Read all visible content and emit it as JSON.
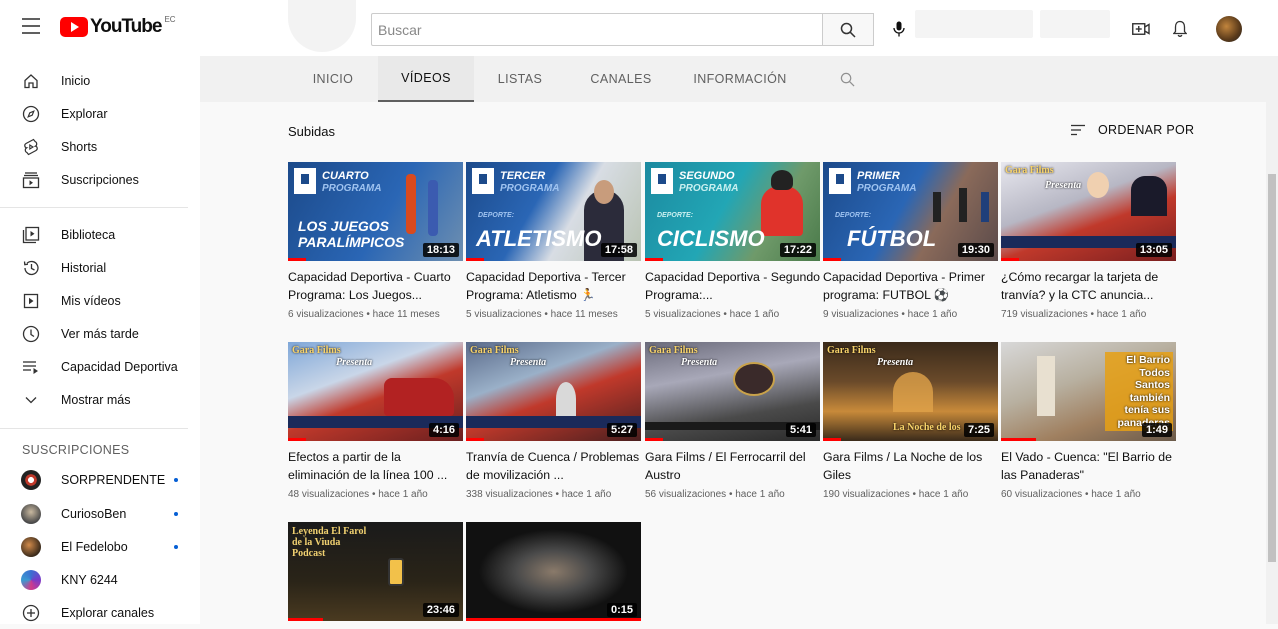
{
  "header": {
    "logo_text": "YouTube",
    "country_code": "EC",
    "search_placeholder": "Buscar"
  },
  "sidebar": {
    "main": [
      {
        "label": "Inicio",
        "icon": "home-icon"
      },
      {
        "label": "Explorar",
        "icon": "compass-icon"
      },
      {
        "label": "Shorts",
        "icon": "shorts-icon"
      },
      {
        "label": "Suscripciones",
        "icon": "subscriptions-icon"
      }
    ],
    "library": [
      {
        "label": "Biblioteca",
        "icon": "library-icon"
      },
      {
        "label": "Historial",
        "icon": "history-icon"
      },
      {
        "label": "Mis vídeos",
        "icon": "my-videos-icon"
      },
      {
        "label": "Ver más tarde",
        "icon": "clock-icon"
      },
      {
        "label": "Capacidad Deportiva",
        "icon": "playlist-icon"
      },
      {
        "label": "Mostrar más",
        "icon": "chevron-down-icon"
      }
    ],
    "subscriptions_heading": "SUSCRIPCIONES",
    "subscriptions": [
      {
        "label": "SORPRENDENTE",
        "new": true
      },
      {
        "label": "CuriosoBen",
        "new": true
      },
      {
        "label": "El Fedelobo",
        "new": true
      },
      {
        "label": "KNY 6244",
        "new": false
      }
    ],
    "explore_channels": "Explorar canales"
  },
  "tabs": [
    {
      "label": "INICIO",
      "active": false
    },
    {
      "label": "VÍDEOS",
      "active": true
    },
    {
      "label": "LISTAS",
      "active": false
    },
    {
      "label": "CANALES",
      "active": false
    },
    {
      "label": "INFORMACIÓN",
      "active": false
    }
  ],
  "section": {
    "title": "Subidas",
    "sort_label": "ORDENAR POR"
  },
  "videos": [
    {
      "title": "Capacidad Deportiva - Cuarto Programa: Los Juegos...",
      "views": "6 visualizaciones",
      "age": "hace 11 meses",
      "duration": "18:13",
      "thumb_line1": "CUARTO",
      "thumb_line2": "PROGRAMA",
      "thumb_main": "LOS JUEGOS PARALÍMPICOS",
      "progress": 0.1
    },
    {
      "title": "Capacidad Deportiva - Tercer Programa: Atletismo 🏃",
      "views": "5 visualizaciones",
      "age": "hace 11 meses",
      "duration": "17:58",
      "thumb_line1": "TERCER",
      "thumb_line2": "PROGRAMA",
      "thumb_sub": "DEPORTE:",
      "thumb_main": "ATLETISMO",
      "progress": 0.1
    },
    {
      "title": "Capacidad Deportiva - Segundo Programa:...",
      "views": "5 visualizaciones",
      "age": "hace 1 año",
      "duration": "17:22",
      "thumb_line1": "SEGUNDO",
      "thumb_line2": "PROGRAMA",
      "thumb_sub": "DEPORTE:",
      "thumb_main": "CICLISMO",
      "progress": 0.1
    },
    {
      "title": "Capacidad Deportiva - Primer programa: FUTBOL ⚽",
      "views": "9 visualizaciones",
      "age": "hace 1 año",
      "duration": "19:30",
      "thumb_line1": "PRIMER",
      "thumb_line2": "PROGRAMA",
      "thumb_sub": "DEPORTE:",
      "thumb_main": "FÚTBOL",
      "progress": 0.1
    },
    {
      "title": "¿Cómo recargar la tarjeta de tranvía? y la CTC anuncia...",
      "views": "719 visualizaciones",
      "age": "hace 1 año",
      "duration": "13:05",
      "thumb_brand": "Gara Films",
      "thumb_sub": "Presenta",
      "progress": 0.1
    },
    {
      "title": "Efectos a partir de la eliminación de la línea 100 ...",
      "views": "48 visualizaciones",
      "age": "hace 1 año",
      "duration": "4:16",
      "thumb_brand": "Gara Films",
      "thumb_sub": "Presenta",
      "progress": 0.1
    },
    {
      "title": "Tranvía de Cuenca / Problemas de movilización ...",
      "views": "338 visualizaciones",
      "age": "hace 1 año",
      "duration": "5:27",
      "thumb_brand": "Gara Films",
      "thumb_sub": "Presenta",
      "progress": 0.1
    },
    {
      "title": "Gara Films / El Ferrocarril del Austro",
      "views": "56 visualizaciones",
      "age": "hace 1 año",
      "duration": "5:41",
      "thumb_brand": "Gara Films",
      "thumb_sub": "Presenta",
      "progress": 0.1
    },
    {
      "title": "Gara Films / La Noche de los Giles",
      "views": "190 visualizaciones",
      "age": "hace 1 año",
      "duration": "7:25",
      "thumb_brand": "Gara Films",
      "thumb_sub": "Presenta",
      "thumb_main": "La Noche de los",
      "progress": 0.1
    },
    {
      "title": "El Vado - Cuenca: \"El Barrio de las Panaderas\"",
      "views": "60 visualizaciones",
      "age": "hace 1 año",
      "duration": "1:49",
      "thumb_main": "El Barrio Todos Santos también tenía sus panaderas",
      "progress": 0.2
    },
    {
      "title": "",
      "views": "",
      "age": "",
      "duration": "23:46",
      "thumb_main": "Leyenda El Farol de la Viuda Podcast",
      "progress": 0.2
    },
    {
      "title": "",
      "views": "",
      "age": "",
      "duration": "0:15",
      "progress": 1.0
    }
  ],
  "colors": {
    "accent": "#ff0000",
    "blue": "#065fd4"
  }
}
